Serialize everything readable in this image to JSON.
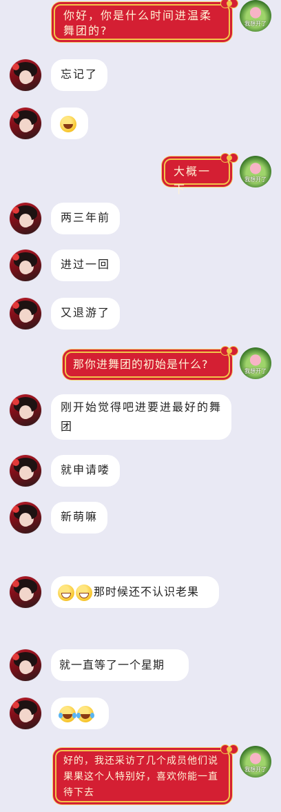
{
  "chat": {
    "right_avatar_caption": "我想开了",
    "messages": [
      {
        "side": "right",
        "text": "你好，你是什么时间进温柔舞团的?"
      },
      {
        "side": "left",
        "text": "忘记了"
      },
      {
        "side": "left",
        "emoji": "grinning-face"
      },
      {
        "side": "right",
        "text": "大概一下"
      },
      {
        "side": "left",
        "text": "两三年前"
      },
      {
        "side": "left",
        "text": "进过一回"
      },
      {
        "side": "left",
        "text": "又退游了"
      },
      {
        "side": "right",
        "text": "那你进舞团的初始是什么?"
      },
      {
        "side": "left",
        "text": "刚开始觉得吧进要进最好的舞团"
      },
      {
        "side": "left",
        "text": "就申请喽"
      },
      {
        "side": "left",
        "text": "新萌嘛"
      },
      {
        "side": "left",
        "text": "那时候还不认识老果"
      },
      {
        "side": "left",
        "text": "就一直等了一个星期"
      },
      {
        "side": "left",
        "emoji": "tears-of-joy"
      },
      {
        "side": "right",
        "text": "好的，我还采访了几个成员他们说果果这个人特别好，喜欢你能一直待下去"
      }
    ]
  }
}
